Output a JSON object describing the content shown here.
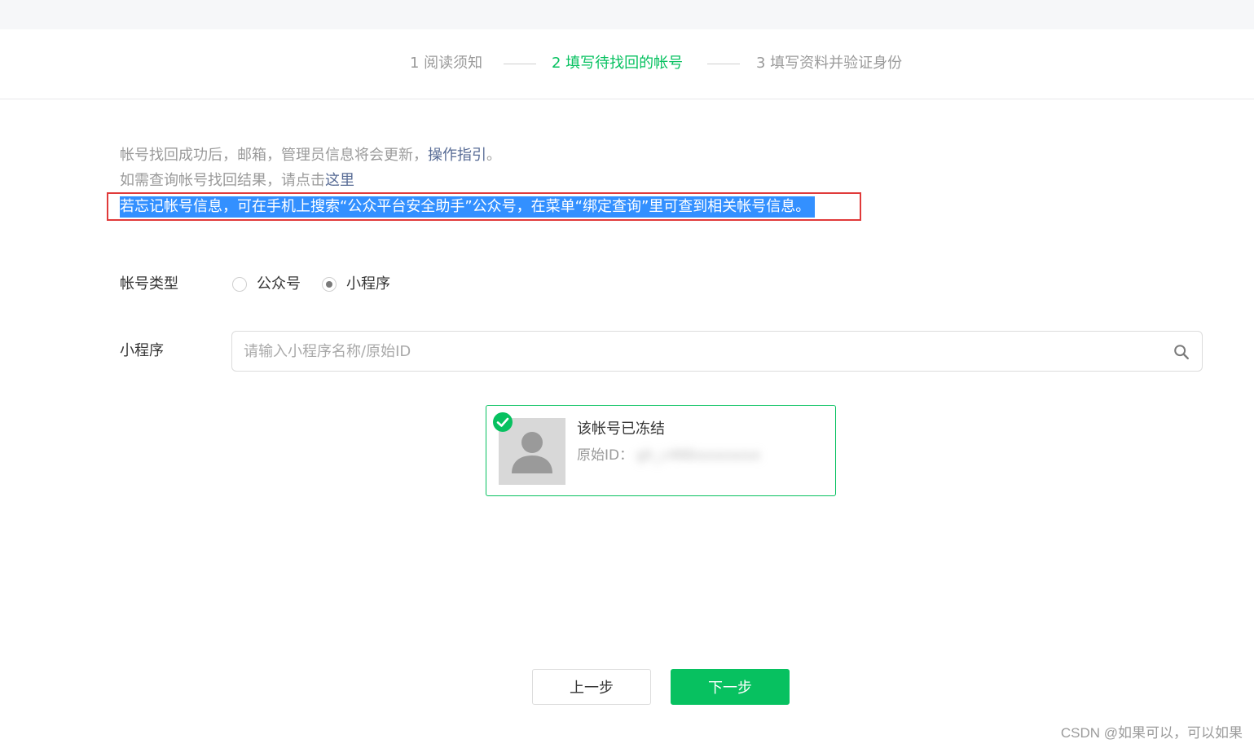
{
  "steps": [
    {
      "label": "1 阅读须知",
      "active": false
    },
    {
      "label": "2 填写待找回的帐号",
      "active": true
    },
    {
      "label": "3 填写资料并验证身份",
      "active": false
    }
  ],
  "notices": {
    "line1_text": "帐号找回成功后，邮箱，管理员信息将会更新，",
    "line1_link": "操作指引",
    "line1_end": "。",
    "line2_text": "如需查询帐号找回结果，请点击",
    "line2_link": "这里",
    "line3_text": "若忘记帐号信息，可在手机上搜索“公众平台安全助手”公众号，在菜单“绑定查询”里可查到相关帐号信息。"
  },
  "form": {
    "account_type_label": "帐号类型",
    "options": [
      {
        "label": "公众号",
        "checked": false
      },
      {
        "label": "小程序",
        "checked": true
      }
    ],
    "search_label": "小程序",
    "search_placeholder": "请输入小程序名称/原始ID",
    "search_value": ""
  },
  "account_card": {
    "name": "该帐号已冻结",
    "id_label": "原始ID：",
    "id_value": "gh_c466xxxxxxxx",
    "selected": true
  },
  "buttons": {
    "prev": "上一步",
    "next": "下一步"
  },
  "watermark": "CSDN @如果可以，可以如果",
  "colors": {
    "accent": "#07c160",
    "link": "#576b95",
    "highlight": "#3390ff",
    "annotation_box": "#e03a3a"
  }
}
